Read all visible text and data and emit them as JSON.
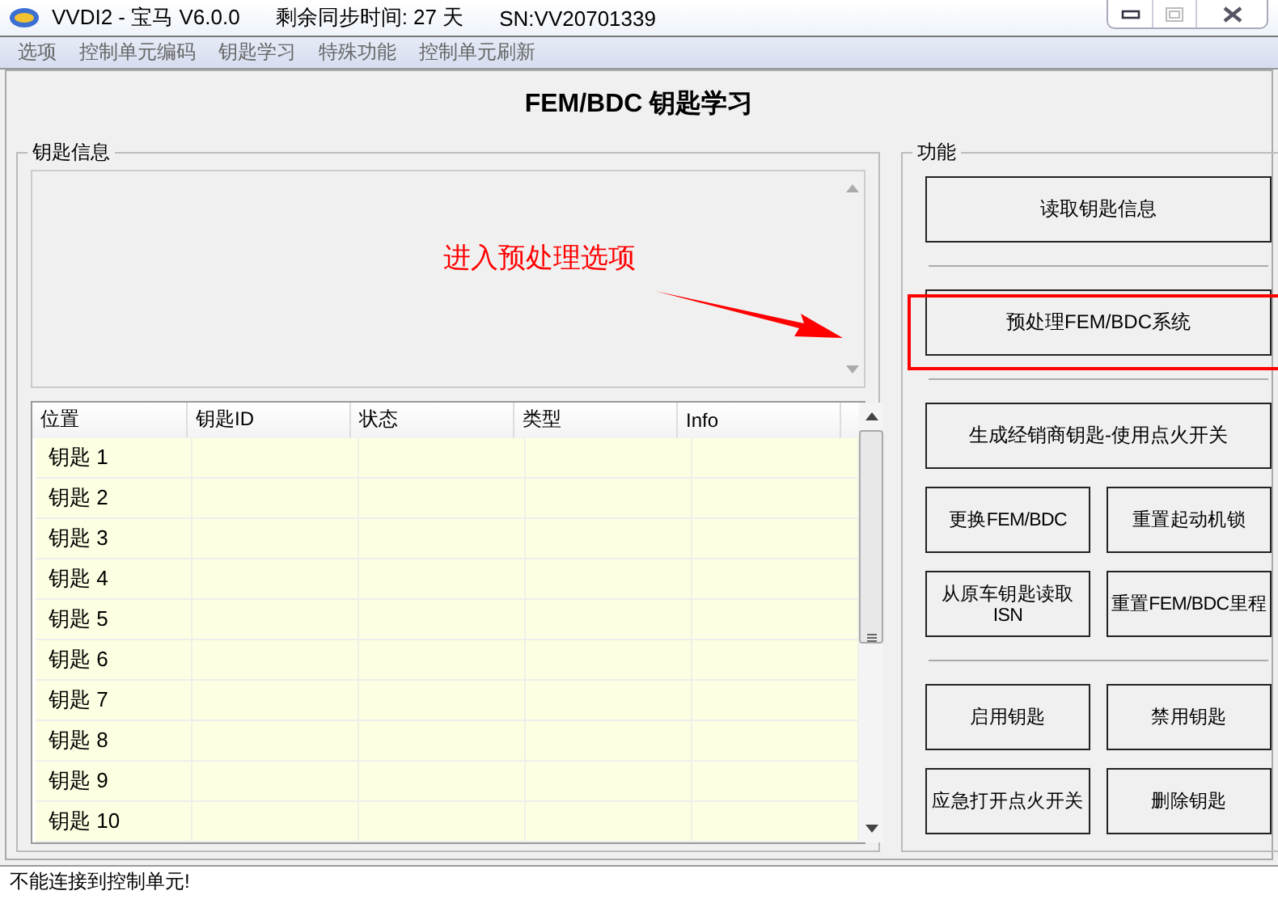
{
  "window": {
    "title": "VVDI2 - 宝马 V6.0.0",
    "sync_info": "剩余同步时间: 27 天",
    "serial": "SN:VV20701339"
  },
  "menu": [
    "选项",
    "控制单元编码",
    "钥匙学习",
    "特殊功能",
    "控制单元刷新"
  ],
  "heading": "FEM/BDC 钥匙学习",
  "key_info": {
    "title": "钥匙信息",
    "annotation": "进入预处理选项",
    "table": {
      "columns": [
        "位置",
        "钥匙ID",
        "状态",
        "类型",
        "Info"
      ],
      "rows": [
        [
          "钥匙 1"
        ],
        [
          "钥匙 2"
        ],
        [
          "钥匙 3"
        ],
        [
          "钥匙 4"
        ],
        [
          "钥匙 5"
        ],
        [
          "钥匙 6"
        ],
        [
          "钥匙 7"
        ],
        [
          "钥匙 8"
        ],
        [
          "钥匙 9"
        ],
        [
          "钥匙 10"
        ]
      ]
    }
  },
  "functions": {
    "title": "功能",
    "sections": [
      [
        {
          "label": "读取钥匙信息",
          "kind": "wide",
          "highlighted": false
        }
      ],
      [
        {
          "label": "预处理FEM/BDC系统",
          "kind": "wide",
          "highlighted": true
        }
      ],
      [
        {
          "label": "生成经销商钥匙-使用点火开关",
          "kind": "wide",
          "highlighted": false
        },
        {
          "label": "更换FEM/BDC",
          "kind": "half",
          "highlighted": false
        },
        {
          "label": "重置起动机锁",
          "kind": "half",
          "highlighted": false
        },
        {
          "label": "从原车钥匙读取ISN",
          "kind": "half",
          "highlighted": false
        },
        {
          "label": "重置FEM/BDC里程",
          "kind": "half",
          "highlighted": false
        }
      ],
      [
        {
          "label": "启用钥匙",
          "kind": "half",
          "highlighted": false
        },
        {
          "label": "禁用钥匙",
          "kind": "half",
          "highlighted": false
        },
        {
          "label": "应急打开点火开关",
          "kind": "half",
          "highlighted": false
        },
        {
          "label": "删除钥匙",
          "kind": "half",
          "highlighted": false
        }
      ]
    ]
  },
  "status_bar": "不能连接到控制单元!"
}
